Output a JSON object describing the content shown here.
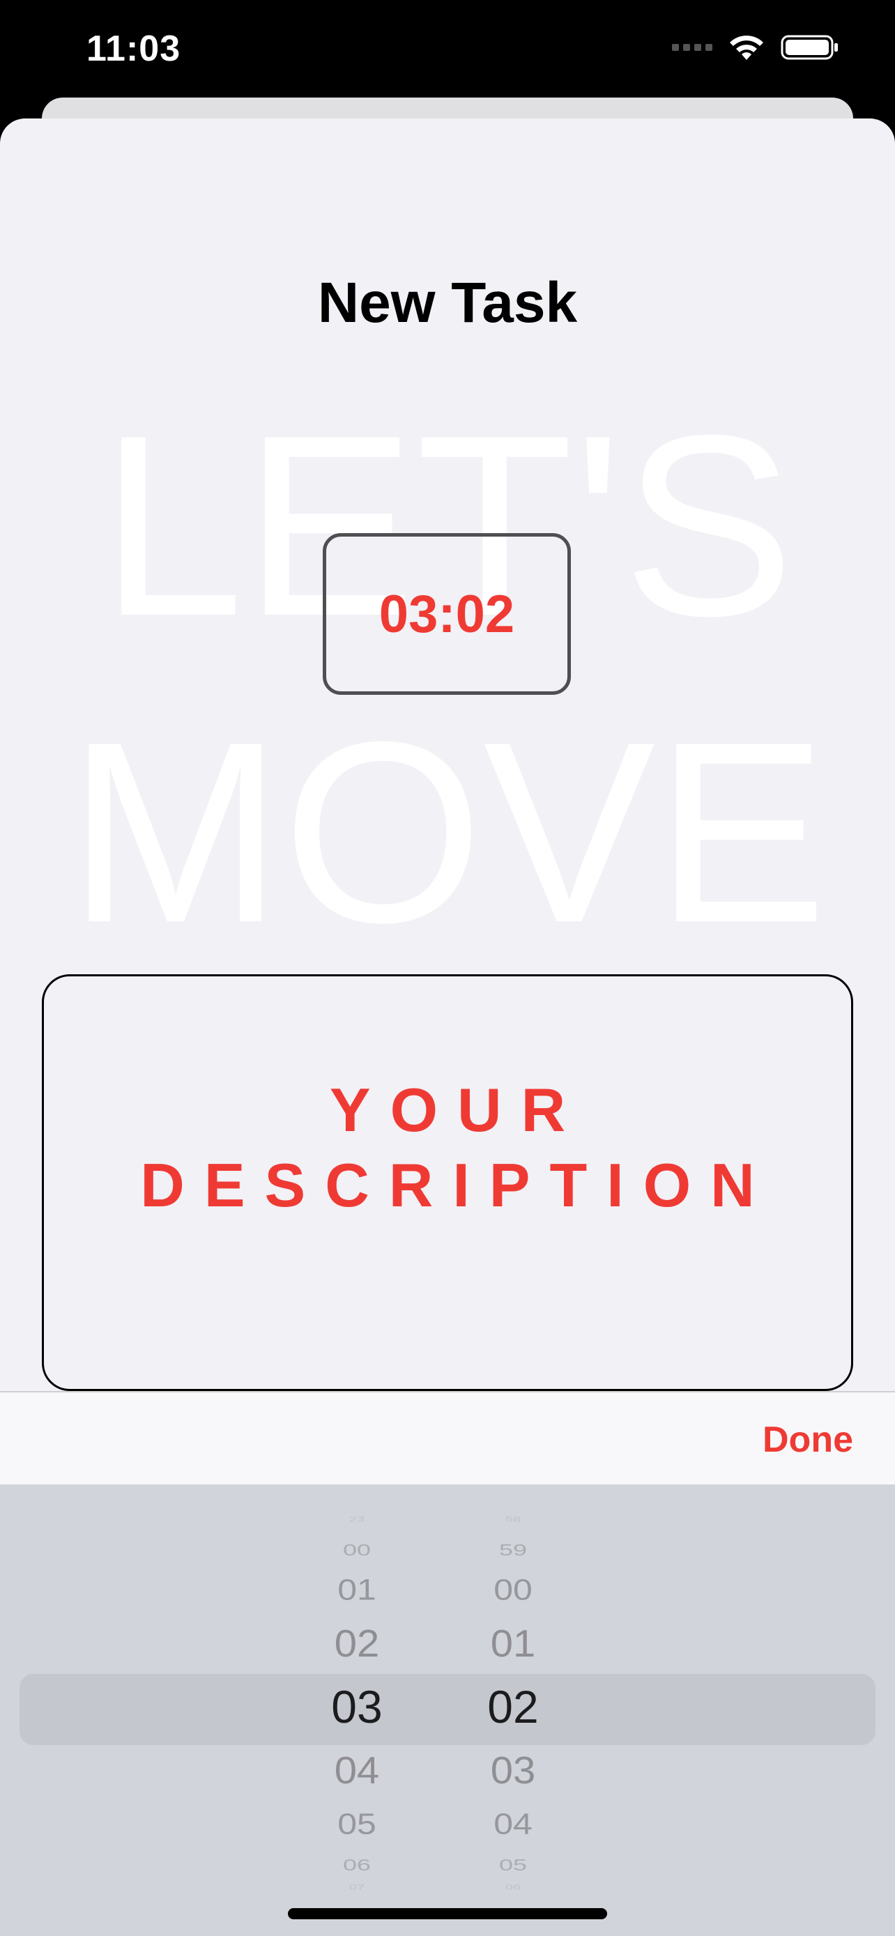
{
  "status_bar": {
    "time": "11:03"
  },
  "sheet": {
    "title": "New Task",
    "background_words": [
      "LET'S",
      "MOVE"
    ],
    "timer_value": "03:02",
    "description_lines": [
      "YOUR",
      "DESCRIPTION"
    ]
  },
  "toolbar": {
    "done_label": "Done"
  },
  "picker": {
    "hours": [
      "23",
      "00",
      "01",
      "02",
      "03",
      "04",
      "05",
      "06",
      "07"
    ],
    "minutes": [
      "58",
      "59",
      "00",
      "01",
      "02",
      "03",
      "04",
      "05",
      "06"
    ],
    "selected_hour": "03",
    "selected_minute": "02"
  },
  "colors": {
    "accent": "#ef3a34",
    "sheet_background": "#f2f1f6",
    "picker_background": "#d1d4da"
  },
  "icons": [
    "cellular-signal-icon",
    "wifi-icon",
    "battery-icon"
  ]
}
